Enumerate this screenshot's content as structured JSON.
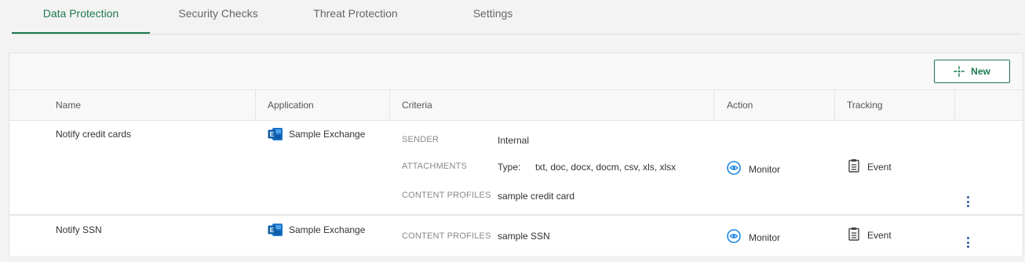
{
  "tabs": [
    {
      "label": "Data Protection",
      "active": true
    },
    {
      "label": "Security Checks",
      "active": false
    },
    {
      "label": "Threat Protection",
      "active": false
    },
    {
      "label": "Settings",
      "active": false
    }
  ],
  "toolbar": {
    "new_label": "New"
  },
  "columns": {
    "name": "Name",
    "application": "Application",
    "criteria": "Criteria",
    "action": "Action",
    "tracking": "Tracking"
  },
  "rows": [
    {
      "name": "Notify credit cards",
      "application": "Sample Exchange",
      "criteria": {
        "sender_label": "SENDER",
        "sender_value": "Internal",
        "attachments_label": "ATTACHMENTS",
        "attachments_type_label": "Type:",
        "attachments_types": "txt, doc, docx, docm, csv, xls, xlsx",
        "content_profiles_label": "CONTENT PROFILES",
        "content_profiles_value": "sample credit card"
      },
      "action": "Monitor",
      "tracking": "Event"
    },
    {
      "name": "Notify SSN",
      "application": "Sample Exchange",
      "criteria": {
        "content_profiles_label": "CONTENT PROFILES",
        "content_profiles_value": "sample SSN"
      },
      "action": "Monitor",
      "tracking": "Event"
    }
  ],
  "colors": {
    "accent": "#1e7a4f",
    "exchange_blue": "#1a73c9",
    "monitor_blue": "#1e88e5",
    "kebab": "#2c5aa0"
  }
}
